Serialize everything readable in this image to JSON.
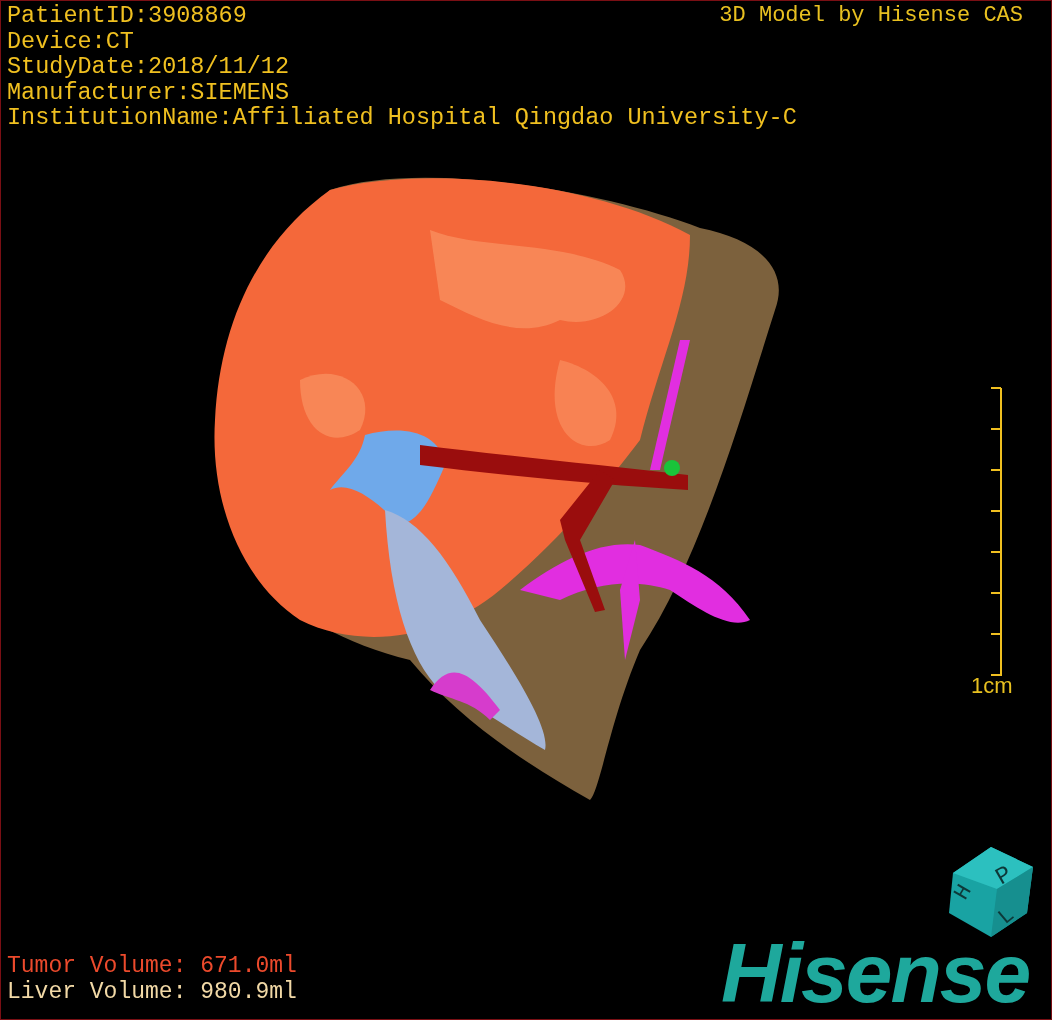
{
  "patient_info": [
    "PatientID:3908869",
    "Device:CT",
    "StudyDate:2018/11/12",
    "Manufacturer:SIEMENS",
    "InstitutionName:Affiliated Hospital Qingdao University-C"
  ],
  "credit": "3D Model by Hisense CAS",
  "scale_bar": {
    "label": "1cm"
  },
  "volumes": [
    {
      "kind": "tumor",
      "label": "Tumor Volume:",
      "value": "671.0ml"
    },
    {
      "kind": "liver",
      "label": "Liver Volume:",
      "value": "980.9ml"
    }
  ],
  "orientation_cube": {
    "faces": [
      "H",
      "P",
      "L"
    ]
  },
  "logo": "Hisense"
}
